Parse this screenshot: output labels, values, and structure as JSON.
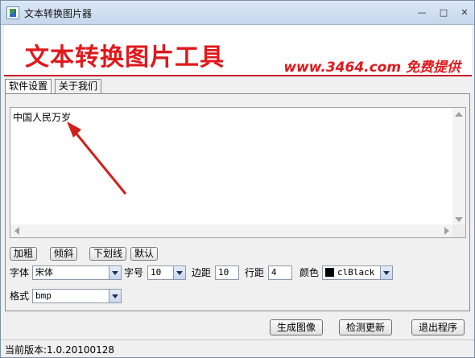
{
  "window": {
    "title": "文本转换图片器"
  },
  "banner": {
    "title": "文本转换图片工具",
    "subtitle": "www.3464.com 免费提供"
  },
  "tabs": [
    {
      "label": "软件设置"
    },
    {
      "label": "关于我们"
    }
  ],
  "editor": {
    "text": "中国人民万岁"
  },
  "style_buttons": {
    "bold": "加粗",
    "italic": "倾斜",
    "underline": "下划线",
    "default": "默认"
  },
  "fields": {
    "font_label": "字体",
    "font_value": "宋体",
    "size_label": "字号",
    "size_value": "10",
    "margin_label": "边距",
    "margin_value": "10",
    "line_spacing_label": "行距",
    "line_spacing_value": "4",
    "color_label": "颜色",
    "color_value": "clBlack",
    "color_hex": "#000000",
    "format_label": "格式",
    "format_value": "bmp"
  },
  "actions": {
    "generate": "生成图像",
    "check_update": "检测更新",
    "exit": "退出程序"
  },
  "status": {
    "version": "当前版本:1.0.20100128"
  },
  "colors": {
    "banner_red": "#e0181c",
    "annotation_red": "#d0201c"
  }
}
